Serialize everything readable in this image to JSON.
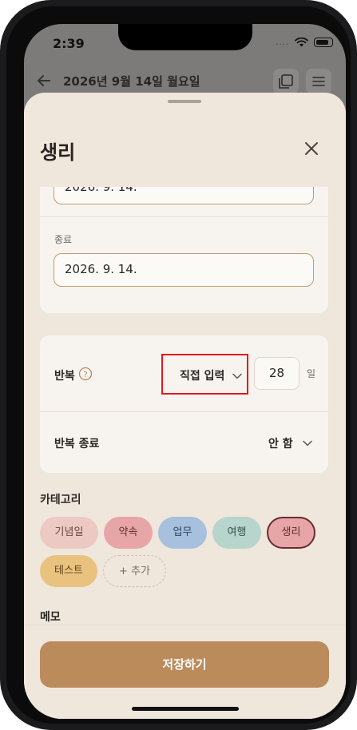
{
  "status_bar": {
    "time": "2:39",
    "signal": "...."
  },
  "background_header": {
    "date_title": "2026년 9월 14일 월요일"
  },
  "sheet": {
    "title": "생리",
    "dates": {
      "start_value": "2026. 9. 14.",
      "end_label": "종료",
      "end_value": "2026. 9. 14."
    },
    "repeat": {
      "label": "반복",
      "mode_value": "직접 입력",
      "days_value": "28",
      "days_unit": "일",
      "end_label": "반복 종료",
      "end_value": "안 함"
    },
    "category": {
      "label": "카테고리",
      "chips": [
        {
          "label": "기념일",
          "bg": "#ecc9c3",
          "fg": "#6e4a45"
        },
        {
          "label": "약속",
          "bg": "#e8a5a8",
          "fg": "#5e2e33"
        },
        {
          "label": "업무",
          "bg": "#a7c0de",
          "fg": "#2f4663"
        },
        {
          "label": "여행",
          "bg": "#b7d4cd",
          "fg": "#34524b"
        },
        {
          "label": "생리",
          "bg": "#e8a5a8",
          "fg": "#5e2e33",
          "selected": true
        },
        {
          "label": "테스트",
          "bg": "#e9c27f",
          "fg": "#5e4517"
        }
      ],
      "add_label": "+ 추가"
    },
    "memo_label": "메모",
    "save_label": "저장하기"
  },
  "colors": {
    "accent": "#bb8b5c",
    "sheet_bg": "#efe6dc",
    "highlight_box": "#e31919"
  }
}
